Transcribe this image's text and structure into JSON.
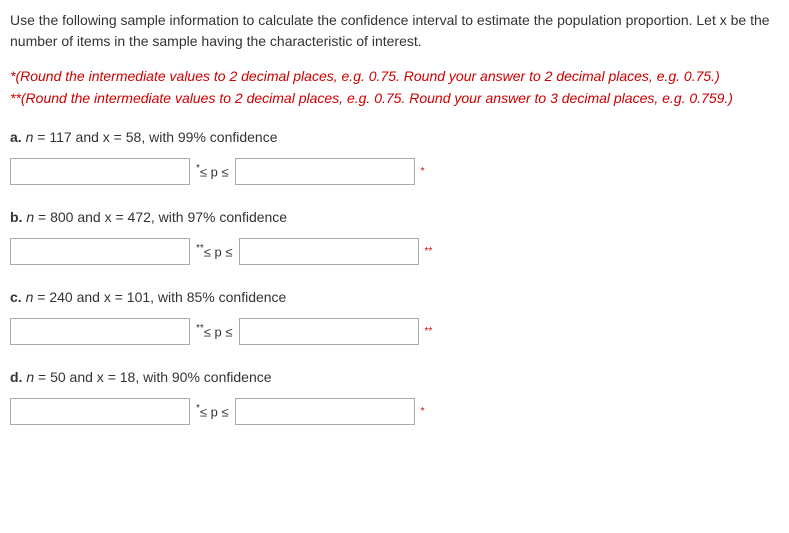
{
  "intro": "Use the following sample information to calculate the confidence interval to estimate the population proportion. Let x be the number of items in the sample having the characteristic of interest.",
  "rounding": {
    "line1": "*(Round the intermediate values to 2 decimal places, e.g. 0.75. Round your answer to 2 decimal places, e.g. 0.75.)",
    "line2": "**(Round the intermediate values to 2 decimal places, e.g. 0.75. Round your answer to 3 decimal places, e.g. 0.759.)"
  },
  "sep_core": "≤ p ≤",
  "parts": {
    "a": {
      "label": "a.",
      "body": " = 117 and x = 58, with 99% confidence",
      "stars": "*"
    },
    "b": {
      "label": "b.",
      "body": " = 800 and x = 472, with 97% confidence",
      "stars": "**"
    },
    "c": {
      "label": "c.",
      "body": " = 240 and x = 101, with 85% confidence",
      "stars": "**"
    },
    "d": {
      "label": "d.",
      "body": " = 50 and x = 18, with 90% confidence",
      "stars": "*"
    }
  }
}
